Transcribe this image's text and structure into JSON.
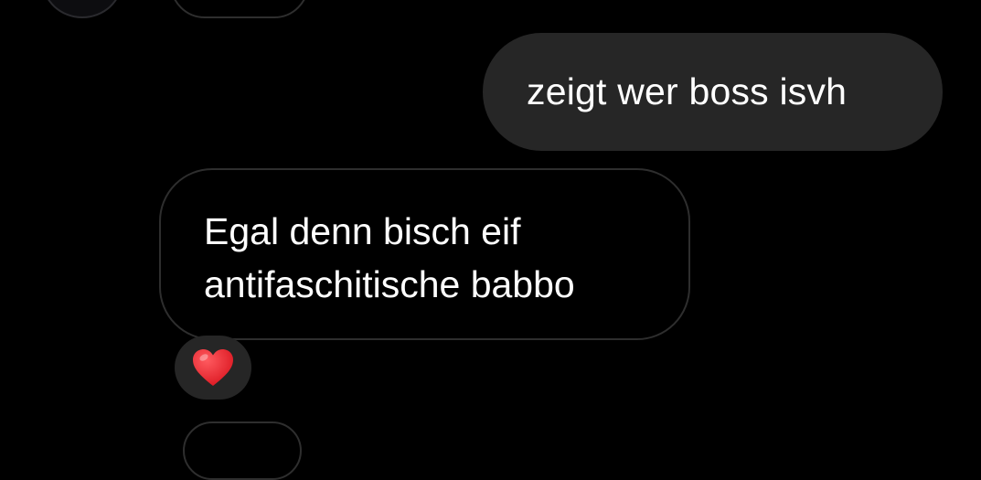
{
  "messages": [
    {
      "direction": "outgoing",
      "lines": [
        "zeigt wer boss isvh"
      ]
    },
    {
      "direction": "incoming",
      "lines": [
        "Egal denn bisch eif",
        "antifaschitische babbo"
      ]
    }
  ],
  "reaction": {
    "icon": "red-heart-icon",
    "color": "#e8202a"
  },
  "colors": {
    "background": "#000000",
    "outgoing_bubble": "#262626",
    "incoming_border": "#2e2e2e",
    "text": "#ffffff"
  }
}
